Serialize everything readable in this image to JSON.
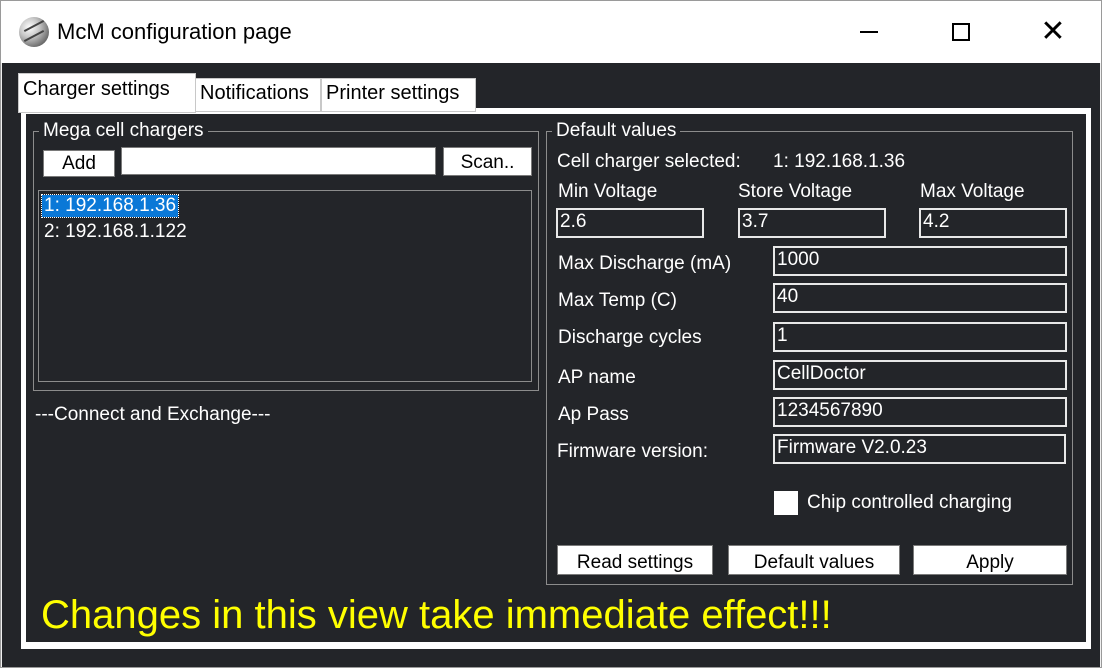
{
  "window": {
    "title": "McM configuration page",
    "icon": "app-logo-icon",
    "controls": {
      "minimize": "minimize-icon",
      "maximize": "maximize-icon",
      "close": "✕"
    }
  },
  "tabs": [
    {
      "label": "Charger settings",
      "active": true
    },
    {
      "label": "Notifications",
      "active": false
    },
    {
      "label": "Printer settings",
      "active": false
    }
  ],
  "chargers_group": {
    "legend": "Mega cell chargers",
    "add_label": "Add",
    "address_value": "",
    "scan_label": "Scan..",
    "items": [
      "1: 192.168.1.36",
      "2: 192.168.1.122"
    ],
    "selected_index": 0,
    "status": "---Connect and Exchange---"
  },
  "defaults_group": {
    "legend": "Default values",
    "selected_label": "Cell charger selected:",
    "selected_value": "1: 192.168.1.36",
    "min_voltage_label": "Min Voltage",
    "min_voltage": "2.6",
    "store_voltage_label": "Store Voltage",
    "store_voltage": "3.7",
    "max_voltage_label": "Max Voltage",
    "max_voltage": "4.2",
    "max_discharge_label": "Max Discharge (mA)",
    "max_discharge": "1000",
    "max_temp_label": "Max Temp (C)",
    "max_temp": "40",
    "discharge_cycles_label": "Discharge cycles",
    "discharge_cycles": "1",
    "ap_name_label": "AP name",
    "ap_name": "CellDoctor",
    "ap_pass_label": "Ap Pass",
    "ap_pass": "1234567890",
    "firmware_label": "Firmware version:",
    "firmware": "Firmware V2.0.23",
    "chip_charging_label": "Chip controlled charging",
    "chip_charging_checked": false,
    "read_settings_label": "Read settings",
    "default_values_label": "Default values",
    "apply_label": "Apply"
  },
  "notice": "Changes in this view take immediate effect!!!",
  "colors": {
    "background": "#232529",
    "notice": "#ffff00",
    "selection": "#0a78d7"
  }
}
